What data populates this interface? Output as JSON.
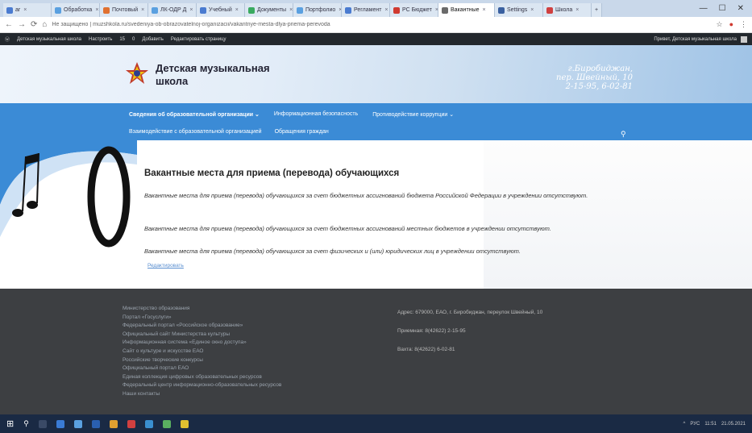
{
  "browser": {
    "tabs": [
      {
        "label": "ar",
        "color": "#4a7bd0"
      },
      {
        "label": "Обработка",
        "color": "#5aa0e0"
      },
      {
        "label": "Почтовый",
        "color": "#e07030"
      },
      {
        "label": "ЛК-ОДР Д",
        "color": "#5aa0e0"
      },
      {
        "label": "Учебный",
        "color": "#4a7bd0"
      },
      {
        "label": "Документы",
        "color": "#3aaa60"
      },
      {
        "label": "Портфолио",
        "color": "#5aa0e0"
      },
      {
        "label": "Регламент",
        "color": "#4a7bd0"
      },
      {
        "label": "РС Бюджет",
        "color": "#d03a30"
      },
      {
        "label": "Вакантные",
        "color": "#6a6a6a",
        "active": true
      },
      {
        "label": "Settings",
        "color": "#3a60a0"
      },
      {
        "label": "Школа",
        "color": "#d04040"
      }
    ],
    "address": "Не защищено | muzshkola.ru/svedeniya-ob-obrazovatelnoj-organizacii/vakantnye-mesta-dlya-priema-perevoda"
  },
  "wpbar": {
    "items": [
      "Детская музыкальная школа",
      "Настроить",
      "15",
      "0",
      "Добавить",
      "Редактировать страницу"
    ],
    "user": "Привет, Детская музыкальная школа"
  },
  "site": {
    "name_line1": "Детская музыкальная",
    "name_line2": "школа",
    "city": "г.Биробиджан,",
    "street": "пер. Швейный, 10",
    "phones": "2-15-95, 6-02-81"
  },
  "menu": {
    "row1": [
      "Сведения об образовательной организации",
      "Информационная безопасность",
      "Противодействие коррупции"
    ],
    "row2": [
      "Взаимодействие с образовательной организацией",
      "Обращения граждан"
    ]
  },
  "page": {
    "title": "Вакантные места для приема (перевода) обучающихся",
    "p1": "Вакантные места для приема (перевода) обучающихся за счет бюджетных ассигнований бюджета Российской Федерации в учреждении отсутствуют.",
    "p2": "Вакантные места для приема (перевода) обучающихся за счет бюджетных ассигнований местных бюджетов в учреждении отсутствуют.",
    "p3": "Вакантные места для приема (перевода) обучающихся за счет физических и (или) юридических лиц в учреждении отсутствуют.",
    "edit_link": "Редактировать"
  },
  "footer": {
    "links": [
      "Министерство образования",
      "Портал «Госуслуги»",
      "Федеральный портал «Российское образование»",
      "Официальный сайт Министерства культуры",
      "Информационная система «Единое окно доступа»",
      "Сайт о культуре и искусстве ЕАО",
      "Российские творческие конкурсы",
      "Официальный портал ЕАО",
      "Единая коллекция цифровых образовательных ресурсов",
      "Федеральный центр информационно-образовательных ресурсов",
      "Наши контакты"
    ],
    "address": "Адрес: 679000, ЕАО, г. Биробиджан, переулок Швейный, 10",
    "reception": "Приемная: 8(42622) 2-15-95",
    "accounting": "Вахта: 8(42622) 6-02-81"
  },
  "taskbar": {
    "time": "11:51",
    "date": "21.05.2021",
    "lang": "РУС"
  }
}
